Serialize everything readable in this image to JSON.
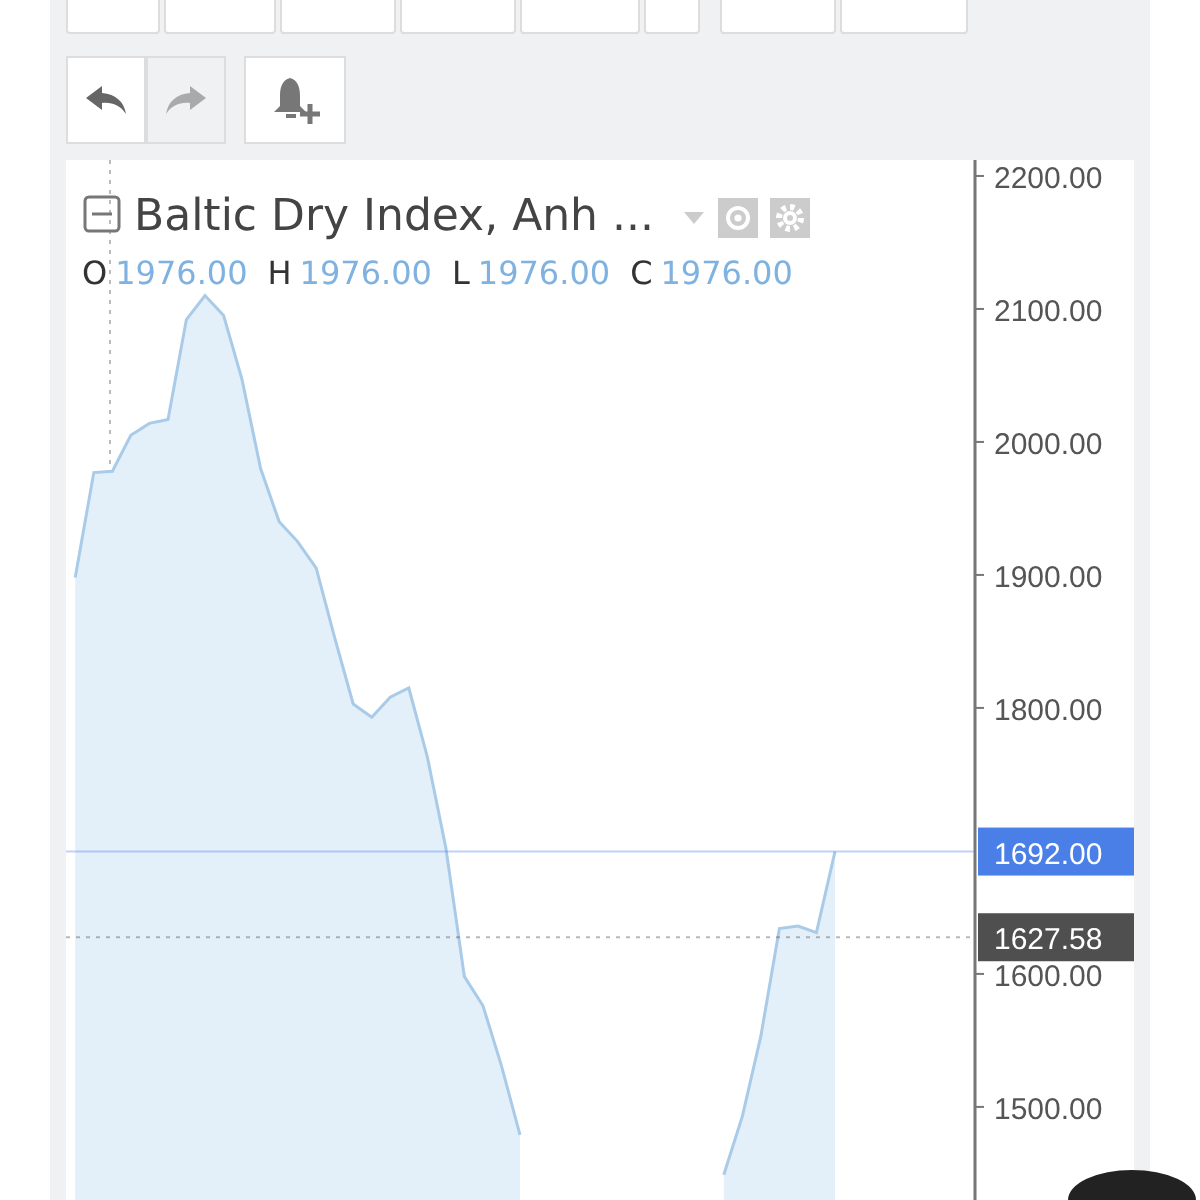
{
  "history": {
    "undo": {
      "disabled": false
    },
    "redo": {
      "disabled": true
    }
  },
  "legend": {
    "title": "Baltic Dry Index, Anh ...",
    "ohlc": [
      {
        "label": "O",
        "value": "1976.00"
      },
      {
        "label": "H",
        "value": "1976.00"
      },
      {
        "label": "L",
        "value": "1976.00"
      },
      {
        "label": "C",
        "value": "1976.00"
      }
    ]
  },
  "chart_data": {
    "type": "area",
    "ylim": [
      1430,
      2212
    ],
    "yticks": [
      {
        "value": 1500,
        "label": "1500.00"
      },
      {
        "value": 1600,
        "label": "1600.00"
      },
      {
        "value": 1800,
        "label": "1800.00"
      },
      {
        "value": 1900,
        "label": "1900.00"
      },
      {
        "value": 2000,
        "label": "2000.00"
      },
      {
        "value": 2100,
        "label": "2100.00"
      },
      {
        "value": 2200,
        "label": "2200.00"
      }
    ],
    "series": [
      {
        "color": "#a9cbe8",
        "values": [
          1898,
          1977,
          1978,
          2005,
          2014,
          2017,
          2092,
          2110,
          2095,
          2047,
          1980,
          1940,
          1925,
          1905,
          1853,
          1803,
          1793,
          1808,
          1815,
          1763,
          1695,
          1598,
          1576,
          1531,
          1479,
          null,
          null,
          null,
          null,
          null,
          null,
          null,
          null,
          null,
          null,
          1449,
          1493,
          1553,
          1634,
          1636,
          1631,
          1692,
          null,
          null,
          null,
          null,
          null,
          null,
          null
        ]
      }
    ],
    "ref_lines": [
      {
        "axis": "y",
        "value": 1692,
        "label": "1692.00",
        "color": "#4a7fe8"
      },
      {
        "axis": "y",
        "value": 1627.58,
        "label": "1627.58",
        "color": "#4f4f4f"
      }
    ]
  }
}
